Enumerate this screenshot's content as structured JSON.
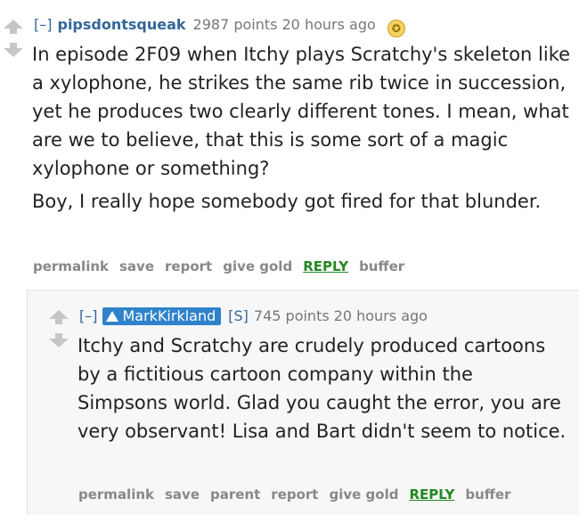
{
  "parent": {
    "expand": "[–]",
    "author": "pipsdontsqueak",
    "score": "2987 points",
    "time": "20 hours ago",
    "gilded_icon": "gold-star-icon",
    "paragraphs": [
      "In episode 2F09 when Itchy plays Scratchy's skeleton like a xylophone, he strikes the same rib twice in succession, yet he produces two clearly different tones. I mean, what are we to believe, that this is some sort of a magic xylophone or something?",
      "Boy, I really hope somebody got fired for that blunder."
    ],
    "buttons": {
      "permalink": "permalink",
      "save": "save",
      "report": "report",
      "give_gold": "give gold",
      "reply": "REPLY",
      "buffer": "buffer"
    }
  },
  "child": {
    "expand": "[–]",
    "author": "MarkKirkland",
    "submitter_flag": "[S]",
    "score": "745 points",
    "time": "20 hours ago",
    "paragraphs": [
      "Itchy and Scratchy are crudely produced cartoons by a fictitious cartoon company within the Simpsons world. Glad you caught the error, you are very observant! Lisa and Bart didn't seem to notice."
    ],
    "buttons": {
      "permalink": "permalink",
      "save": "save",
      "parent": "parent",
      "report": "report",
      "give_gold": "give gold",
      "reply": "REPLY",
      "buffer": "buffer"
    }
  }
}
